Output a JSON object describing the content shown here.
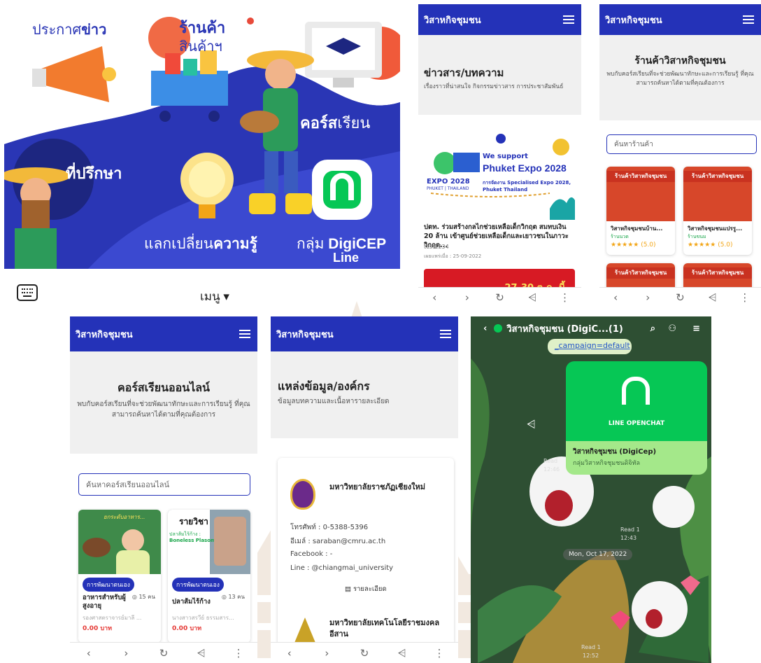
{
  "banner": {
    "news_a": "ประกาศ",
    "news_b": "ข่าว",
    "shop_a": "ร้านค้า",
    "shop_b": "สินค้าฯ",
    "course_a": "คอร์ส",
    "course_b": "เรียน",
    "advisor": "ที่ปรึกษา",
    "exchange_a": "แลกเปลี่ยน",
    "exchange_b": "ความรู้",
    "group_a": "กลุ่ม ",
    "group_b": "DigiCEP",
    "group_c": "Line"
  },
  "menu": {
    "label": "เมนู ▾"
  },
  "site": {
    "brand": "วิสาหกิจชุมชน"
  },
  "news_page": {
    "title": "ข่าวสาร/บทความ",
    "subtitle": "เรื่องราวที่น่าสนใจ กิจกรรมข่าวสาร การประชาสัมพันธ์",
    "poster": {
      "we": "We support",
      "phuket": "Phuket Expo 2028",
      "expo": "EXPO 2028",
      "expo_sub": "PHUKET | THAILAND",
      "desc": "การจัดงาน Specialised Expo 2028, Phuket Thailand"
    },
    "headline": "ปตท. ร่วมสร้างกลไกช่วยเหลือเด็กวิกฤต สมทบเงิน 20 ล้าน เข้าศูนย์ช่วยเหลือเด็กและเยาวชนในภาวะวิกฤต...",
    "author": "test1234",
    "date": "เผยแพร่เมื่อ : 25-09-2022",
    "next_banner": "27-30 ต.ค. นี้"
  },
  "shop_page": {
    "title": "ร้านค้าวิสาหกิจชุมชน",
    "subtitle": "พบกับคอร์สเรียนที่จะช่วยพัฒนาทักษะและการเรียนรู้ ที่คุณสามารถค้นหาได้ตามที่คุณต้องการ",
    "search_placeholder": "ค้นหาร้านค้า",
    "banner_label": "ร้านค้าวิสาหกิจชุมชน",
    "items": [
      {
        "name": "วิสาหกิจชุมชนบ้าน...",
        "type": "ร้านนวด",
        "rating": "★★★★★ (5.0)"
      },
      {
        "name": "วิสาหกิจชุมชนแปรรู...",
        "type": "ร้านขนม",
        "rating": "★★★★★ (5.0)"
      }
    ]
  },
  "course_page": {
    "title": "คอร์สเรียนออนไลน์",
    "subtitle": "พบกับคอร์สเรียนที่จะช่วยพัฒนาทักษะและการเรียนรู้ ที่คุณสามารถค้นหาได้ตามที่คุณต้องการ",
    "search_placeholder": "ค้นหาคอร์สเรียนออนไลน์",
    "items": [
      {
        "tag": "การพัฒนาตนเอง",
        "title": "อาหารสำหรับผู้สูงอายุ",
        "count": "◎ 15 คน",
        "teacher": "รองศาสตราจารย์มาลี ...",
        "price": "0.00 บาท",
        "img_text": "ยกระดับอาหาร..."
      },
      {
        "tag": "การพัฒนาตนเอง",
        "title": "ปลาส้มไร้ก้าง",
        "count": "◎ 13 คน",
        "teacher": "นางสาวสรวีย์ ธรรมสาร...",
        "price": "0.00 บาท",
        "img_text": "รายวิชา",
        "img_sub": "ปลาส้มไร้ก้าง :",
        "img_en": "Boneless Plasom"
      }
    ]
  },
  "org_page": {
    "title": "แหล่งข้อมูล/องค์กร",
    "subtitle": "ข้อมูลบทความและเนื้อหารายละเอียด",
    "org1": {
      "name": "มหาวิทยาลัยราชภัฏเชียงใหม่",
      "phone": "โทรศัพท์ : 0-5388-5396",
      "email": "อีเมล์ : saraban@cmru.ac.th",
      "facebook": "Facebook : -",
      "line": "Line : @chiangmai_university",
      "detail_button": "▤ รายละเอียด"
    },
    "org2": {
      "name": "มหาวิทยาลัยเทคโนโลยีราชมงคลอีสาน"
    }
  },
  "line_chat": {
    "title": "วิสาหกิจชุมชน (DigiC...(1)",
    "link_text": "_campaign=default",
    "openchat_label": "LINE OPENCHAT",
    "group_name": "วิสาหกิจชุมชน (DigiCep)",
    "group_desc": "กลุ่มวิสาหกิจชุมชนดิจิทัล",
    "read1": "Read",
    "read1_time": "12:46",
    "read2": "Read 1",
    "read2_time": "12:43",
    "date_chip": "Mon, Oct 17, 2022",
    "read3": "Read 1",
    "read3_time": "12:52"
  },
  "nav": {
    "back": "‹",
    "forward": "›",
    "reload": "↻",
    "share": "⩤",
    "more": "⋮"
  },
  "colors": {
    "brand": "#2432b8",
    "line_green": "#06c755",
    "price_red": "#e53935"
  }
}
